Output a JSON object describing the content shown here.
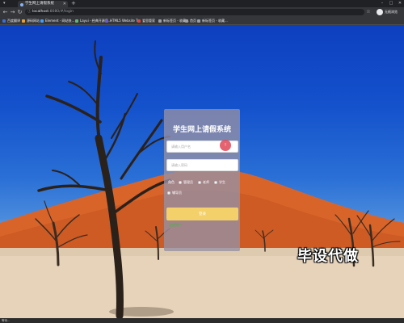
{
  "browser": {
    "tab_title": "学生网上请假系统",
    "url_host": "localhost",
    "url_path": ":8080/#/login",
    "profile_name": "无痕浏览"
  },
  "bookmarks": [
    {
      "label": "百度翻译",
      "color": "#3a6fd8"
    },
    {
      "label": "源码网站",
      "color": "#e8a13a"
    },
    {
      "label": "Element - 网站快...",
      "color": "#409eff"
    },
    {
      "label": "Layui - 经典开源模...",
      "color": "#5fb878"
    },
    {
      "label": "HTML5 Website T...",
      "color": "#6a5acd"
    },
    {
      "label": "爱思管家",
      "color": "#d24a4a"
    },
    {
      "label": "新标签页 - 收藏...",
      "color": "#9aa0a6"
    },
    {
      "label": "首页",
      "color": "#9aa0a6"
    },
    {
      "label": "新标签页 - 收藏...",
      "color": "#9aa0a6"
    }
  ],
  "login": {
    "title": "学生网上请假系统",
    "username_placeholder": "请输入用户名",
    "password_placeholder": "请输入密码",
    "error_badge": "!",
    "role_label": "角色",
    "roles": [
      "管理员",
      "老师",
      "学生",
      "辅导员"
    ],
    "login_button": "登录",
    "register_link": "注册用户"
  },
  "watermark": "毕设代做",
  "status": {
    "text": "等待..."
  },
  "colors": {
    "sky": "#1452cc",
    "dune": "#d9642a",
    "sand": "#e6d3ba",
    "login_button": "#f3d06a",
    "register_link": "#3dbb3d",
    "error_badge": "#e04858"
  }
}
